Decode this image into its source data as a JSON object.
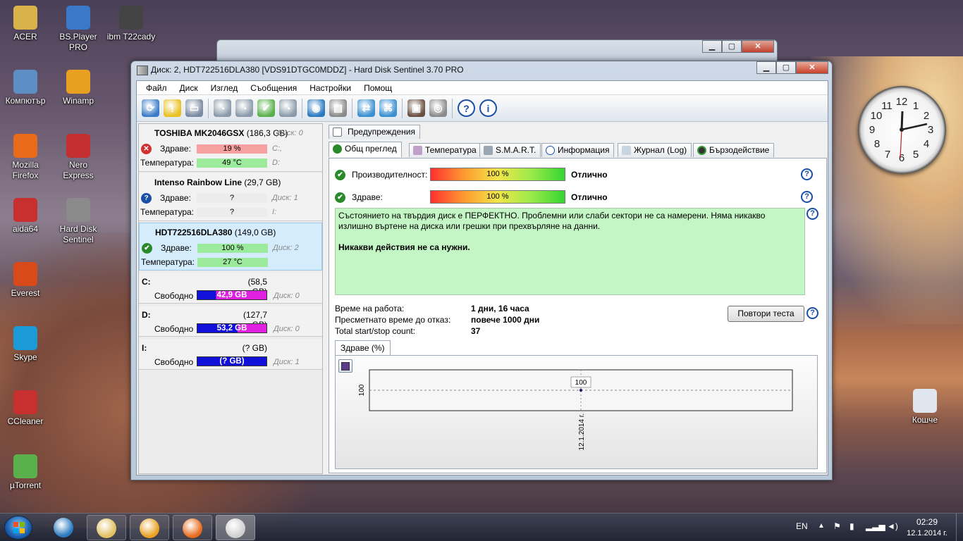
{
  "desktop": {
    "icons": [
      {
        "label": "ACER",
        "color": "#d9b24a"
      },
      {
        "label": "BS.Player PRO",
        "color": "#3b78c9"
      },
      {
        "label": "ibm T22cady",
        "color": "#444444"
      },
      {
        "label": "Компютър",
        "color": "#5d8fc4"
      },
      {
        "label": "Winamp",
        "color": "#e8a020"
      },
      {
        "label": "Mozilla Firefox",
        "color": "#e86a1a"
      },
      {
        "label": "Nero Express",
        "color": "#c43030"
      },
      {
        "label": "aida64",
        "color": "#c83030"
      },
      {
        "label": "Hard Disk Sentinel",
        "color": "#8a8a8a"
      },
      {
        "label": "Everest",
        "color": "#d84a1a"
      },
      {
        "label": "Skype",
        "color": "#1a9bd8"
      },
      {
        "label": "CCleaner",
        "color": "#c83030"
      },
      {
        "label": "µTorrent",
        "color": "#5ab04a"
      },
      {
        "label": "Кошче",
        "color": "#dfe6ee"
      }
    ]
  },
  "window": {
    "title": "Диск: 2, HDT722516DLA380 [VDS91DTGC0MDDZ]  -  Hard Disk Sentinel 3.70 PRO",
    "caption_buttons": [
      "▁",
      "▢",
      "✕"
    ]
  },
  "back_window": {
    "caption_buttons": [
      "▁",
      "▢",
      "✕"
    ]
  },
  "menu": [
    "Файл",
    "Диск",
    "Изглед",
    "Съобщения",
    "Настройки",
    "Помощ"
  ],
  "toolbar_icons": [
    {
      "name": "refresh-icon",
      "color": "#3a7cc8",
      "glyph": "⟳"
    },
    {
      "name": "warning-icon",
      "color": "#e8c020",
      "glyph": "!"
    },
    {
      "name": "disk-icon",
      "color": "#7a8aa0",
      "glyph": "▭"
    },
    {
      "name": "disk-tool-1-icon",
      "color": "#8a9aaa",
      "glyph": "◔"
    },
    {
      "name": "disk-tool-2-icon",
      "color": "#8a9aaa",
      "glyph": "◔"
    },
    {
      "name": "disk-check-icon",
      "color": "#5ab04a",
      "glyph": "✔"
    },
    {
      "name": "disk-tool-3-icon",
      "color": "#8a9aaa",
      "glyph": "◔"
    },
    {
      "name": "globe-icon",
      "color": "#2a7ac0",
      "glyph": "◉"
    },
    {
      "name": "report-icon",
      "color": "#8a8a8a",
      "glyph": "▤"
    },
    {
      "name": "sync-icon",
      "color": "#3a90d0",
      "glyph": "⇄"
    },
    {
      "name": "network-icon",
      "color": "#3a90d0",
      "glyph": "⌘"
    },
    {
      "name": "monitor-icon",
      "color": "#6a5040",
      "glyph": "▣"
    },
    {
      "name": "sound-icon",
      "color": "#8a8a8a",
      "glyph": "◎"
    },
    {
      "name": "help-icon",
      "color": "#1a4fa8",
      "glyph": "?"
    },
    {
      "name": "info-icon",
      "color": "#1a4fa8",
      "glyph": "i"
    }
  ],
  "disks": [
    {
      "name": "TOSHIBA MK2046GSX",
      "size": "(186,3 GB)",
      "tag": "Диск: 0",
      "health_label": "Здраве:",
      "health": "19 %",
      "health_color": "#f7a0a0",
      "temp_label": "Температура:",
      "temp": "49 °C",
      "temp_color": "#9cea9c",
      "tag_health": "C:,",
      "tag_temp": "D:",
      "status_icon": "✕",
      "status_color": "#d03030"
    },
    {
      "name": "Intenso Rainbow Line",
      "size": "(29,7 GB)",
      "tag": "",
      "health_label": "Здраве:",
      "health": "?",
      "health_color": "#ececec",
      "temp_label": "Температура:",
      "temp": "?",
      "temp_color": "#ececec",
      "tag_health": "Диск: 1",
      "tag_temp": "I:",
      "status_icon": "?",
      "status_color": "#1a4fa8"
    },
    {
      "name": "HDT722516DLA380",
      "size": "(149,0 GB)",
      "tag": "",
      "health_label": "Здраве:",
      "health": "100 %",
      "health_color": "#9cea9c",
      "temp_label": "Температура:",
      "temp": "27 °C",
      "temp_color": "#9cea9c",
      "tag_health": "Диск: 2",
      "tag_temp": "",
      "status_icon": "✔",
      "status_color": "#2a8a2a"
    }
  ],
  "partitions": [
    {
      "letter": "C:",
      "size": "(58,5 GB)",
      "free_label": "Свободно",
      "free": "42,9 GB",
      "free_fraction": 0.27,
      "tag": "Диск: 0"
    },
    {
      "letter": "D:",
      "size": "(127,7 GB)",
      "free_label": "Свободно",
      "free": "53,2 GB",
      "free_fraction": 0.58,
      "tag": "Диск: 0"
    },
    {
      "letter": "I:",
      "size": "(? GB)",
      "free_label": "Свободно",
      "free": "(? GB)",
      "free_fraction": 1.0,
      "tag": "Диск: 1"
    }
  ],
  "tabs_top": [
    {
      "label": "Предупреждения"
    }
  ],
  "tabs": [
    {
      "label": "Общ преглед",
      "active": true
    },
    {
      "label": "Температура"
    },
    {
      "label": "S.M.A.R.T."
    },
    {
      "label": "Информация"
    },
    {
      "label": "Журнал (Log)"
    },
    {
      "label": "Бързодействие"
    }
  ],
  "overview": {
    "performance_label": "Производителност:",
    "performance_value": "100 %",
    "performance_rating": "Отлично",
    "health_label": "Здраве:",
    "health_value": "100 %",
    "health_rating": "Отлично",
    "status_text": "Състоянието на твърдия диск е ПЕРФЕКТНО. Проблемни или слаби сектори не са намерени. Няма никакво излишно въртене на диска или грешки при прехвърляне на данни.",
    "status_action": "Никакви действия не са нужни.",
    "uptime_label": "Време на работа:",
    "uptime_value": "1 дни, 16 часа",
    "estimate_label": "Пресметнато време до отказ:",
    "estimate_value": "повече 1000 дни",
    "startstop_label": "Total start/stop count:",
    "startstop_value": "37",
    "retest_button": "Повтори теста",
    "help_glyph": "?"
  },
  "chart_data": {
    "type": "line",
    "tab_label": "Здраве (%)",
    "x": [
      "12.1.2014 г."
    ],
    "values": [
      100
    ],
    "ylabel": "100",
    "point_label": "100"
  },
  "taskbar": {
    "lang": "EN",
    "time": "02:29",
    "date": "12.1.2014 г.",
    "apps": [
      {
        "name": "ie",
        "color": "#2a7ac0"
      },
      {
        "name": "explorer",
        "color": "#e0c060"
      },
      {
        "name": "media",
        "color": "#e8a020"
      },
      {
        "name": "firefox",
        "color": "#e86a1a"
      },
      {
        "name": "hdsentinel",
        "color": "#cfcfcf"
      }
    ]
  }
}
